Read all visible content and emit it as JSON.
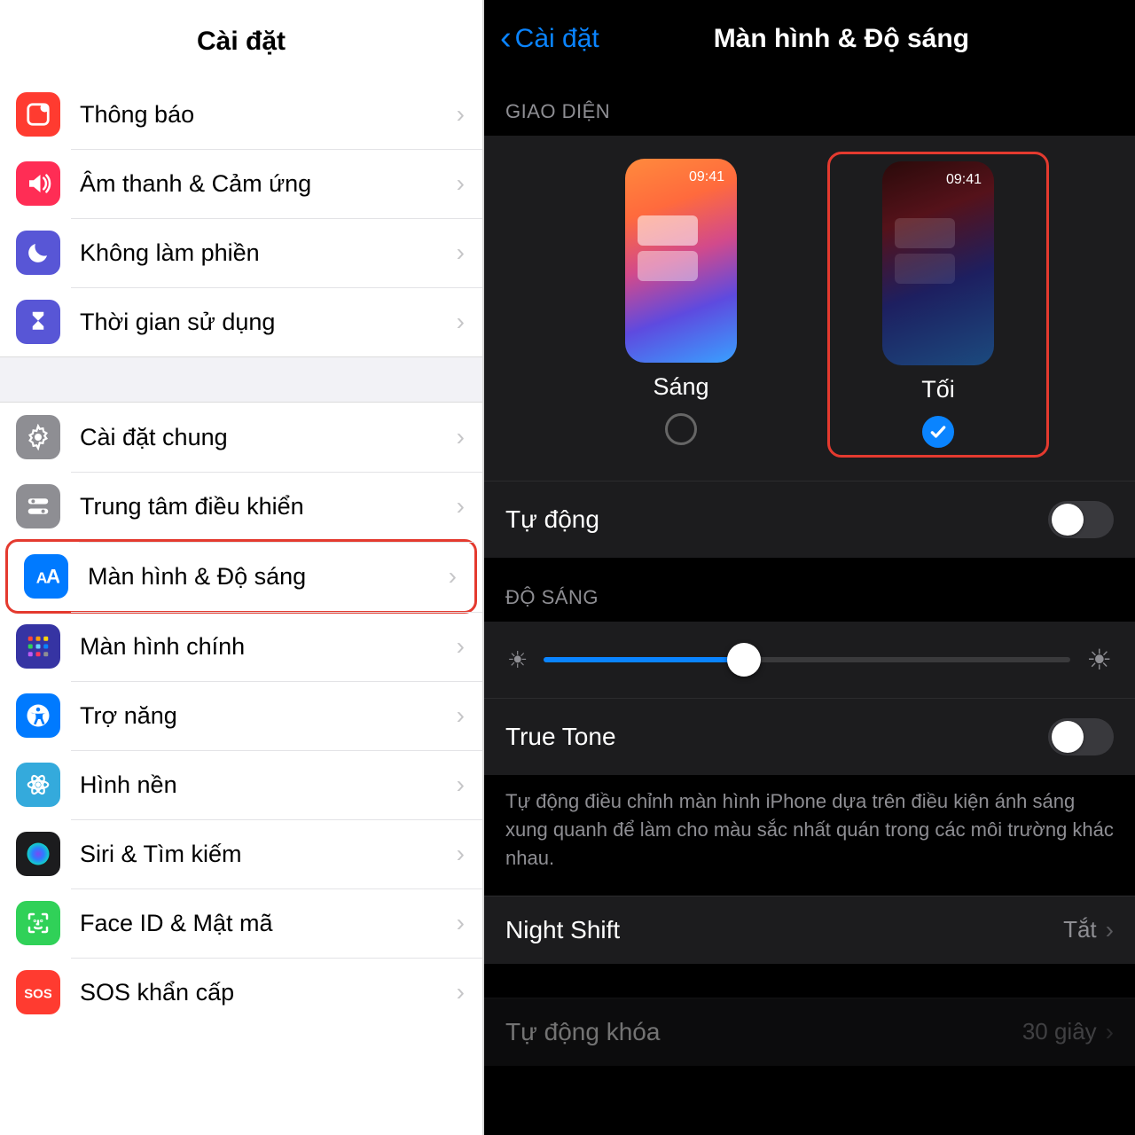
{
  "left": {
    "title": "Cài đặt",
    "groups": [
      [
        {
          "icon": "notifications",
          "bg": "#ff3b30",
          "label": "Thông báo"
        },
        {
          "icon": "sound",
          "bg": "#ff2d55",
          "label": "Âm thanh & Cảm ứng"
        },
        {
          "icon": "moon",
          "bg": "#5856d6",
          "label": "Không làm phiền"
        },
        {
          "icon": "hourglass",
          "bg": "#5856d6",
          "label": "Thời gian sử dụng"
        }
      ],
      [
        {
          "icon": "gear",
          "bg": "#8e8e93",
          "label": "Cài đặt chung"
        },
        {
          "icon": "switches",
          "bg": "#8e8e93",
          "label": "Trung tâm điều khiển"
        },
        {
          "icon": "aa",
          "bg": "#007aff",
          "label": "Màn hình & Độ sáng",
          "highlight": true
        },
        {
          "icon": "grid",
          "bg": "#3634a3",
          "label": "Màn hình chính"
        },
        {
          "icon": "accessibility",
          "bg": "#007aff",
          "label": "Trợ năng"
        },
        {
          "icon": "flower",
          "bg": "#34aadc",
          "label": "Hình nền"
        },
        {
          "icon": "siri",
          "bg": "#1c1c1e",
          "label": "Siri & Tìm kiếm"
        },
        {
          "icon": "faceid",
          "bg": "#30d158",
          "label": "Face ID & Mật mã"
        },
        {
          "icon": "sos",
          "bg": "#ff3b30",
          "label": "SOS khẩn cấp"
        }
      ]
    ]
  },
  "right": {
    "back": "Cài đặt",
    "title": "Màn hình & Độ sáng",
    "appearance_head": "GIAO DIỆN",
    "light_label": "Sáng",
    "dark_label": "Tối",
    "preview_time": "09:41",
    "auto_label": "Tự động",
    "brightness_head": "ĐỘ SÁNG",
    "truetone_label": "True Tone",
    "truetone_desc": "Tự động điều chỉnh màn hình iPhone dựa trên điều kiện ánh sáng xung quanh để làm cho màu sắc nhất quán trong các môi trường khác nhau.",
    "nightshift_label": "Night Shift",
    "nightshift_value": "Tắt",
    "autolock_label": "Tự động khóa",
    "autolock_value": "30 giây"
  }
}
